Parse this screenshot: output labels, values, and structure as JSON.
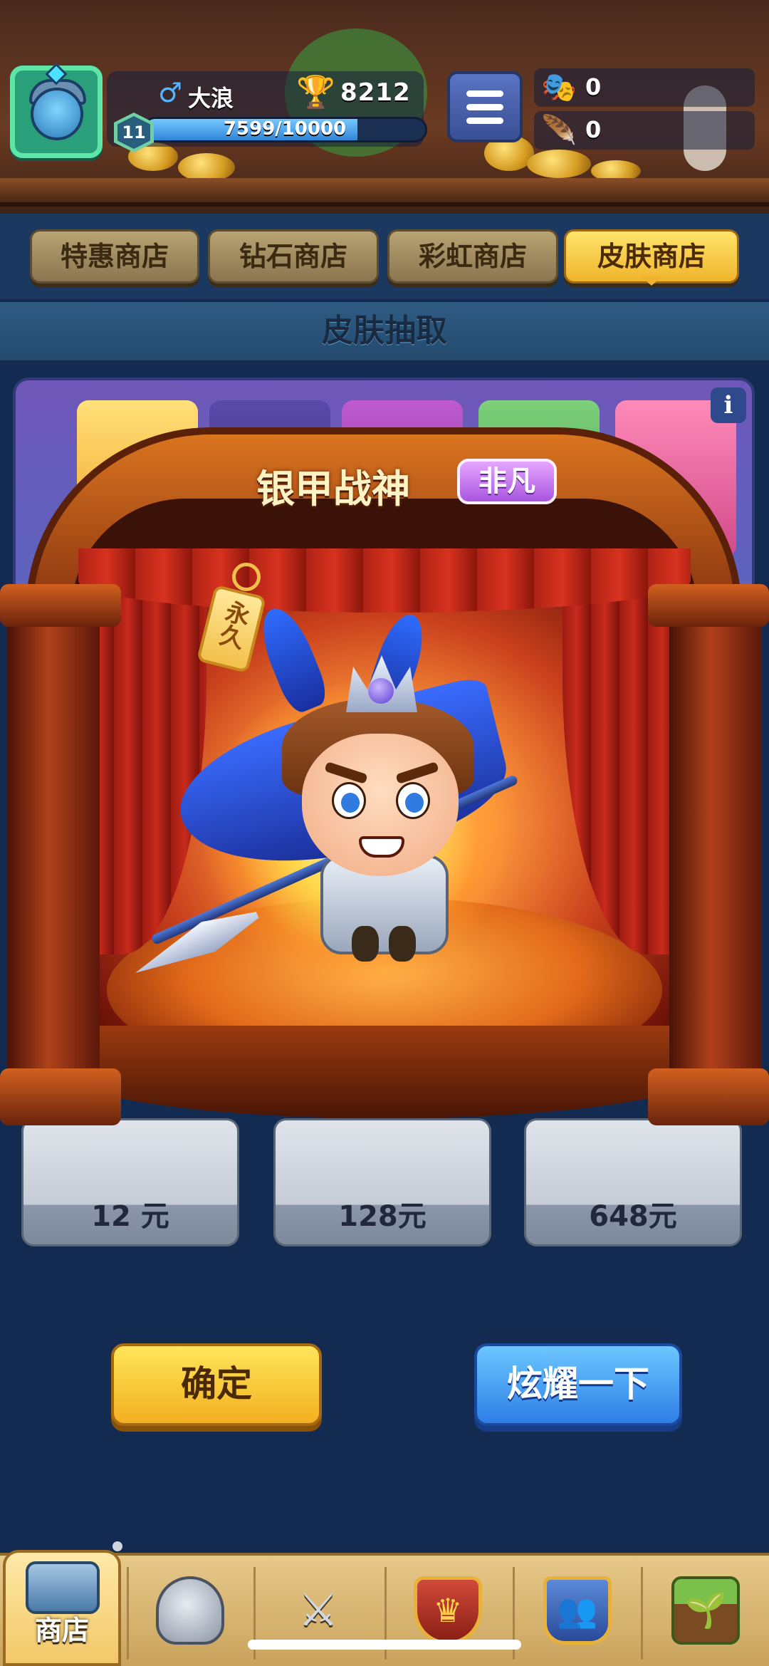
{
  "header": {
    "player_name": "大浪",
    "gender_icon": "male-icon",
    "trophy_count": "8212",
    "level": "11",
    "xp_text": "7599/10000",
    "xp_fraction": 0.7599,
    "currency_masks": "0",
    "currency_feathers": "0"
  },
  "tabs": [
    {
      "label": "特惠商店",
      "active": false
    },
    {
      "label": "钻石商店",
      "active": false
    },
    {
      "label": "彩虹商店",
      "active": false
    },
    {
      "label": "皮肤商店",
      "active": true
    }
  ],
  "section_title": "皮肤抽取",
  "reward_popup": {
    "skin_name": "银甲战神",
    "rarity": "非凡",
    "duration_tag": "永久"
  },
  "price_cards": [
    {
      "label": "12 元"
    },
    {
      "label": "128元"
    },
    {
      "label": "648元"
    }
  ],
  "buttons": {
    "confirm": "确定",
    "show_off": "炫耀一下"
  },
  "bottom_nav": {
    "shop_label": "商店",
    "items": [
      "shop-icon",
      "helmet-icon",
      "crossed-swords-icon",
      "crown-shield-icon",
      "team-banner-icon",
      "sprout-icon"
    ]
  },
  "colors": {
    "accent_gold": "#f3b021",
    "accent_blue": "#2d7fe6",
    "rarity_purple": "#a855e0"
  }
}
